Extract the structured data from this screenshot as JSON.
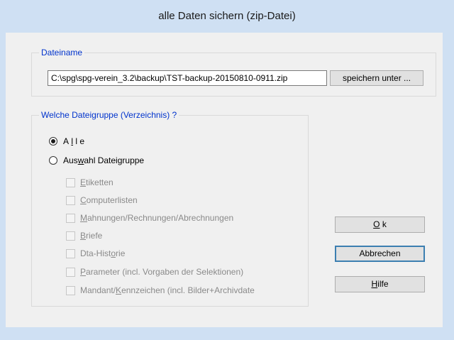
{
  "window": {
    "title": "alle Daten sichern (zip-Datei)"
  },
  "dateiname": {
    "group_title": "Dateiname",
    "path_value": "C:\\spg\\spg-verein_3.2\\backup\\TST-backup-20150810-0911.zip",
    "save_as_button": "speichern unter ..."
  },
  "dateigruppe": {
    "group_title": "Welche Dateigruppe (Verzeichnis) ?",
    "radio_all": {
      "label_parts": [
        "A",
        "l",
        "l",
        "e"
      ],
      "checked": true
    },
    "radio_selection": {
      "label_pre": "Aus",
      "label_u": "w",
      "label_post": "ahl Dateigruppe",
      "checked": false
    },
    "checkboxes": [
      {
        "u": "E",
        "rest": "tiketten",
        "pre": ""
      },
      {
        "u": "C",
        "rest": "omputerlisten",
        "pre": ""
      },
      {
        "u": "M",
        "rest": "ahnungen/Rechnungen/Abrechnungen",
        "pre": ""
      },
      {
        "u": "B",
        "rest": "riefe",
        "pre": ""
      },
      {
        "u": "o",
        "rest": "rie",
        "pre": "Dta-Hist"
      },
      {
        "u": "P",
        "rest": "arameter (incl. Vorgaben der Selektionen)",
        "pre": ""
      },
      {
        "u": "K",
        "rest": "ennzeichen (incl. Bilder+Archivdate",
        "pre": "Mandant/"
      }
    ]
  },
  "buttons": {
    "ok": {
      "u": "O",
      "rest": " k"
    },
    "cancel": "Abbrechen",
    "help": {
      "u": "H",
      "rest": "ilfe"
    }
  }
}
